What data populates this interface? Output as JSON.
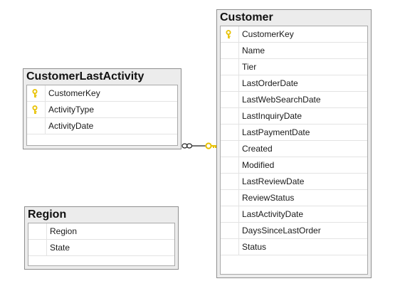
{
  "tables": {
    "customer": {
      "title": "Customer",
      "columns": [
        {
          "name": "CustomerKey",
          "key": true
        },
        {
          "name": "Name",
          "key": false
        },
        {
          "name": "Tier",
          "key": false
        },
        {
          "name": "LastOrderDate",
          "key": false
        },
        {
          "name": "LastWebSearchDate",
          "key": false
        },
        {
          "name": "LastInquiryDate",
          "key": false
        },
        {
          "name": "LastPaymentDate",
          "key": false
        },
        {
          "name": "Created",
          "key": false
        },
        {
          "name": "Modified",
          "key": false
        },
        {
          "name": "LastReviewDate",
          "key": false
        },
        {
          "name": "ReviewStatus",
          "key": false
        },
        {
          "name": "LastActivityDate",
          "key": false
        },
        {
          "name": "DaysSinceLastOrder",
          "key": false
        },
        {
          "name": "Status",
          "key": false
        }
      ]
    },
    "customer_last_activity": {
      "title": "CustomerLastActivity",
      "columns": [
        {
          "name": "CustomerKey",
          "key": true
        },
        {
          "name": "ActivityType",
          "key": true
        },
        {
          "name": "ActivityDate",
          "key": false
        }
      ]
    },
    "region": {
      "title": "Region",
      "columns": [
        {
          "name": "Region",
          "key": false
        },
        {
          "name": "State",
          "key": false
        }
      ]
    }
  },
  "relationship": {
    "from": "CustomerLastActivity",
    "to": "Customer",
    "from_end": "many",
    "to_end": "one"
  },
  "colors": {
    "key_icon": "#e8c100",
    "relationship_key": "#e8c100",
    "title_bar": "#ececec",
    "border": "#8f8f8f"
  }
}
